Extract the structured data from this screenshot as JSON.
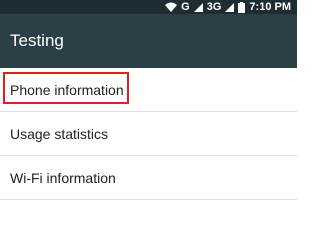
{
  "status_bar": {
    "network_g": "G",
    "network_3g": "3G",
    "time": "7:10 PM",
    "icons": [
      "wifi-icon",
      "signal-icon",
      "signal-icon",
      "battery-icon"
    ]
  },
  "app_bar": {
    "title": "Testing"
  },
  "list": {
    "items": [
      {
        "label": "Phone information"
      },
      {
        "label": "Usage statistics"
      },
      {
        "label": "Wi-Fi information"
      }
    ]
  },
  "colors": {
    "status_bar_bg": "#1f2d33",
    "app_bar_bg": "#2b3f46",
    "highlight_border": "#e02020"
  }
}
